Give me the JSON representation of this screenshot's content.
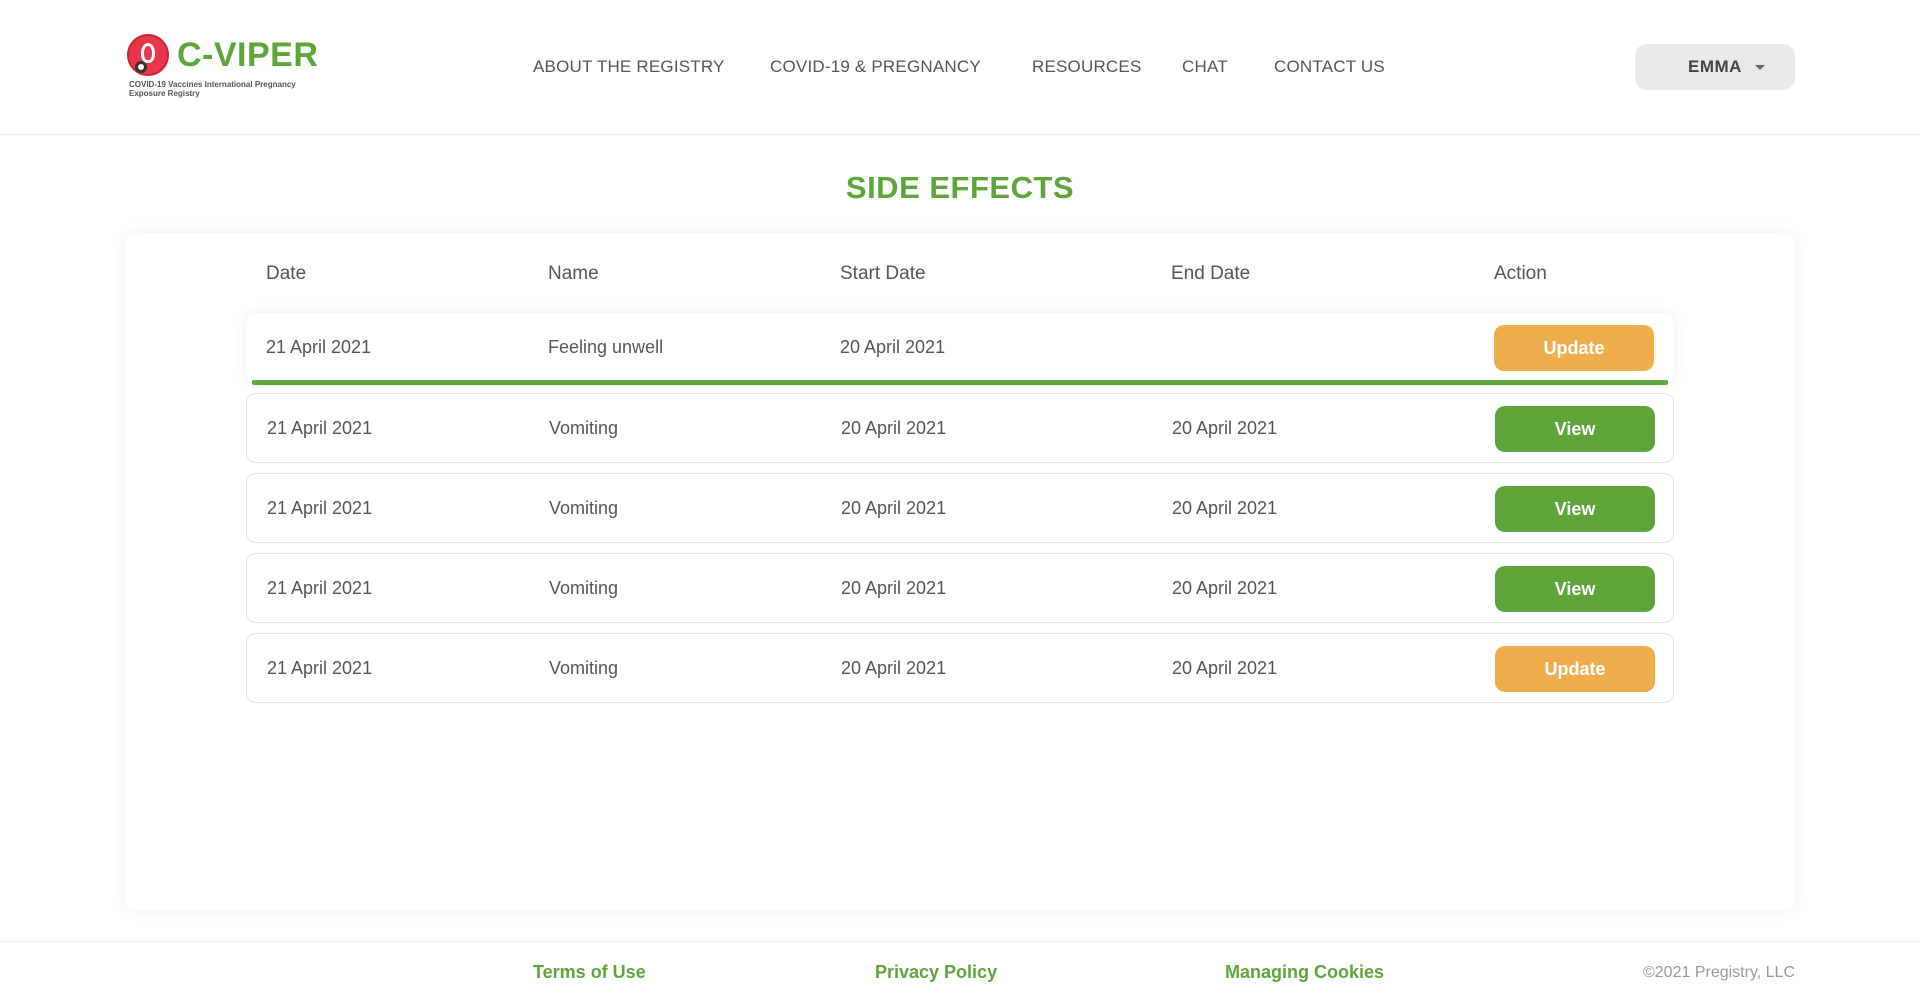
{
  "header": {
    "logo_title": "C-VIPER",
    "logo_subtitle_1": "COVID-19 Vaccines International Pregnancy",
    "logo_subtitle_2": "Exposure Registry",
    "nav": [
      {
        "label": "ABOUT THE REGISTRY"
      },
      {
        "label": "COVID-19 & PREGNANCY"
      },
      {
        "label": "RESOURCES"
      },
      {
        "label": "CHAT"
      },
      {
        "label": "CONTACT US"
      }
    ],
    "user_name": "EMMA"
  },
  "page_title": "SIDE EFFECTS",
  "table": {
    "columns": [
      "Date",
      "Name",
      "Start Date",
      "End Date",
      "Action"
    ],
    "rows": [
      {
        "date": "21 April 2021",
        "name": "Feeling unwell",
        "start": "20 April 2021",
        "end": "",
        "action": "Update",
        "action_type": "update"
      },
      {
        "date": "21 April 2021",
        "name": "Vomiting",
        "start": "20 April 2021",
        "end": "20 April 2021",
        "action": "View",
        "action_type": "view"
      },
      {
        "date": "21 April 2021",
        "name": "Vomiting",
        "start": "20 April 2021",
        "end": "20 April 2021",
        "action": "View",
        "action_type": "view"
      },
      {
        "date": "21 April 2021",
        "name": "Vomiting",
        "start": "20 April 2021",
        "end": "20 April 2021",
        "action": "View",
        "action_type": "view"
      },
      {
        "date": "21 April 2021",
        "name": "Vomiting",
        "start": "20 April 2021",
        "end": "20 April 2021",
        "action": "Update",
        "action_type": "update"
      }
    ]
  },
  "footer": {
    "terms": "Terms of Use",
    "privacy": "Privacy Policy",
    "cookies": "Managing Cookies",
    "copyright": "©2021 Pregistry, LLC"
  },
  "colors": {
    "brand_green": "#5ea63a",
    "update_orange": "#f0ad4e",
    "view_green": "#5ea63a"
  }
}
